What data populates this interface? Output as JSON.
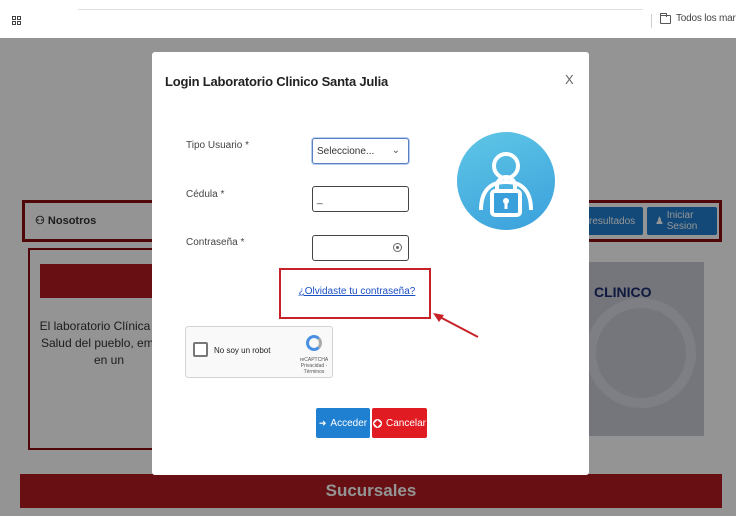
{
  "browser": {
    "bookmarks_folder_label": "Todos los marcadores"
  },
  "page": {
    "nav": {
      "nosotros_label": "Nosotros",
      "resultados_label": "resultados",
      "iniciar_sesion_label": "Iniciar Sesion"
    },
    "content_text": "El laboratorio Clínica Sant\nSalud del pueblo, empres\nen un",
    "logo_text": "CLINICO",
    "sucursales_label": "Sucursales"
  },
  "modal": {
    "title": "Login Laboratorio Clinico Santa Julia",
    "close_label": "X",
    "tipo_usuario_label": "Tipo Usuario",
    "tipo_usuario_value": "Seleccione...",
    "cedula_label": "Cédula",
    "cedula_value": "_",
    "contrasena_label": "Contraseña",
    "required_mark": "*",
    "forgot_link": "¿Olvidaste tu contraseña?",
    "captcha": {
      "label": "No soy un robot",
      "brand": "reCAPTCHA",
      "terms": "Privacidad - Términos"
    },
    "acceder_label": "Acceder",
    "cancelar_label": "Cancelar"
  },
  "colors": {
    "primary_blue": "#1f7fd1",
    "danger_red": "#e01c22",
    "brand_dark_red": "#8b0d12",
    "highlight_red": "#c82127"
  }
}
